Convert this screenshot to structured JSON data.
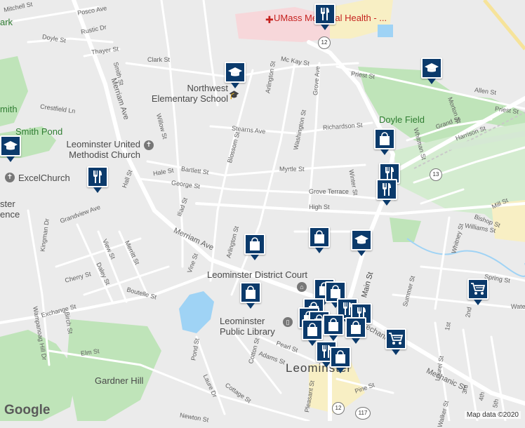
{
  "map": {
    "town_label": "Leominster",
    "attribution": "Map data ©2020",
    "logo": "Google",
    "colors": {
      "background": "#ebebeb",
      "park": "#bfe4b9",
      "water": "#9fd3f5",
      "hospital": "#f7d7da",
      "highway": "#f6e39a",
      "marker": "#0b3a6b"
    }
  },
  "streets": {
    "mitchell": "Mitchell St",
    "posco": "Posco Ave",
    "rustic": "Rustic Dr",
    "doyle": "Doyle St",
    "thayer": "Thayer St",
    "smith": "Smith St",
    "clark": "Clark St",
    "mckay": "Mc Kay St",
    "priest1": "Priest St",
    "priest2": "Priest St",
    "allen": "Allen St",
    "morton": "Morton St",
    "crestfield": "Crestfield Ln",
    "merriam1": "Merriam Ave",
    "merriam2": "Merriam Ave",
    "stearns": "Stearns Ave",
    "richardson": "Richardson St",
    "grand": "Grand St",
    "harrison": "Harrison St",
    "willow": "Willow St",
    "blossom": "Blossom St",
    "arlington1": "Arlington St",
    "arlington2": "Arlington St",
    "washington": "Washington St",
    "grove_ave": "Grove Ave",
    "hale": "Hale St",
    "bartlett": "Bartlett St",
    "george": "George St",
    "myrtle": "Myrtle St",
    "grove_terrace": "Grove Terrace",
    "winter": "Winter St",
    "whitman": "Whitman St",
    "high": "High St",
    "mill": "Mill St",
    "bishop": "Bishop St",
    "williams": "Williams St",
    "whitney": "Whitney St",
    "grandview": "Grandview Ave",
    "hall": "Hall St",
    "iliad": "Iliad St",
    "kingman": "Kingman Dr",
    "view": "View St",
    "merritt": "Merritt St",
    "cherry": "Cherry St",
    "daley": "Daley St",
    "vine": "Vine St",
    "boutelle": "Boutelle St",
    "exchange": "Exchange St",
    "birch": "Birch St",
    "wampanoag": "Wampanoag Hill Dr",
    "elm": "Elm St",
    "pond": "Pond St",
    "laurel_dr": "Laure Dr",
    "cotton": "Cotton St",
    "adams": "Adams St",
    "pearl": "Pearl St",
    "cottage": "Cottage St",
    "pleasant": "Pleasant St",
    "pine": "Pine St",
    "newton": "Newton St",
    "main": "Main St",
    "mechanic1": "Mechanic St",
    "mechanic2": "Mechanic St",
    "spring": "Spring St",
    "water": "Water",
    "second": "2nd",
    "first": "1st",
    "third": "3rd",
    "fourth": "4th",
    "fifth": "5th",
    "laurel": "Laurel St",
    "summer": "Summer St",
    "walker": "Walker St"
  },
  "pois": {
    "hospital": "UMass Memorial Health - ...",
    "school": "Northwest Elementary School",
    "church": "Leominster United Methodist Church",
    "excel": "ExcelChurch",
    "smith_pond": "Smith Pond",
    "ark": "ark",
    "mith": "mith",
    "doyle_field": "Doyle Field",
    "court": "Leominster District Court",
    "library": "Leominster Public Library",
    "gardner_hill": "Gardner Hill",
    "ster": "ster",
    "ence": "ence"
  },
  "routes": {
    "r12a": "12",
    "r12b": "12",
    "r13": "13",
    "r117": "117"
  },
  "markers": [
    {
      "icon": "restaurant",
      "name": "restaurant-marker"
    },
    {
      "icon": "school",
      "name": "school-marker"
    },
    {
      "icon": "school",
      "name": "school-marker"
    },
    {
      "icon": "school",
      "name": "school-marker"
    },
    {
      "icon": "restaurant",
      "name": "restaurant-marker"
    },
    {
      "icon": "shopping-bag",
      "name": "shopping-bag-marker"
    },
    {
      "icon": "restaurant",
      "name": "restaurant-marker"
    },
    {
      "icon": "restaurant",
      "name": "restaurant-marker"
    },
    {
      "icon": "shopping-bag",
      "name": "shopping-bag-marker"
    },
    {
      "icon": "school",
      "name": "school-marker"
    },
    {
      "icon": "shopping-bag",
      "name": "shopping-bag-marker"
    },
    {
      "icon": "shopping-bag",
      "name": "shopping-bag-marker"
    },
    {
      "icon": "shopping-cart",
      "name": "shopping-cart-marker"
    },
    {
      "icon": "shopping-bag",
      "name": "shopping-bag-marker"
    },
    {
      "icon": "shopping-bag",
      "name": "shopping-bag-marker"
    },
    {
      "icon": "shopping-bag",
      "name": "shopping-bag-marker"
    },
    {
      "icon": "restaurant",
      "name": "restaurant-marker"
    },
    {
      "icon": "restaurant",
      "name": "restaurant-marker"
    },
    {
      "icon": "shopping-bag",
      "name": "shopping-bag-marker"
    },
    {
      "icon": "shopping-bag",
      "name": "shopping-bag-marker"
    },
    {
      "icon": "shopping-bag",
      "name": "shopping-bag-marker"
    },
    {
      "icon": "shopping-bag",
      "name": "shopping-bag-marker"
    },
    {
      "icon": "restaurant",
      "name": "restaurant-marker"
    },
    {
      "icon": "shopping-bag",
      "name": "shopping-bag-marker"
    },
    {
      "icon": "shopping-bag",
      "name": "shopping-bag-marker"
    },
    {
      "icon": "shopping-cart",
      "name": "shopping-cart-marker"
    }
  ]
}
